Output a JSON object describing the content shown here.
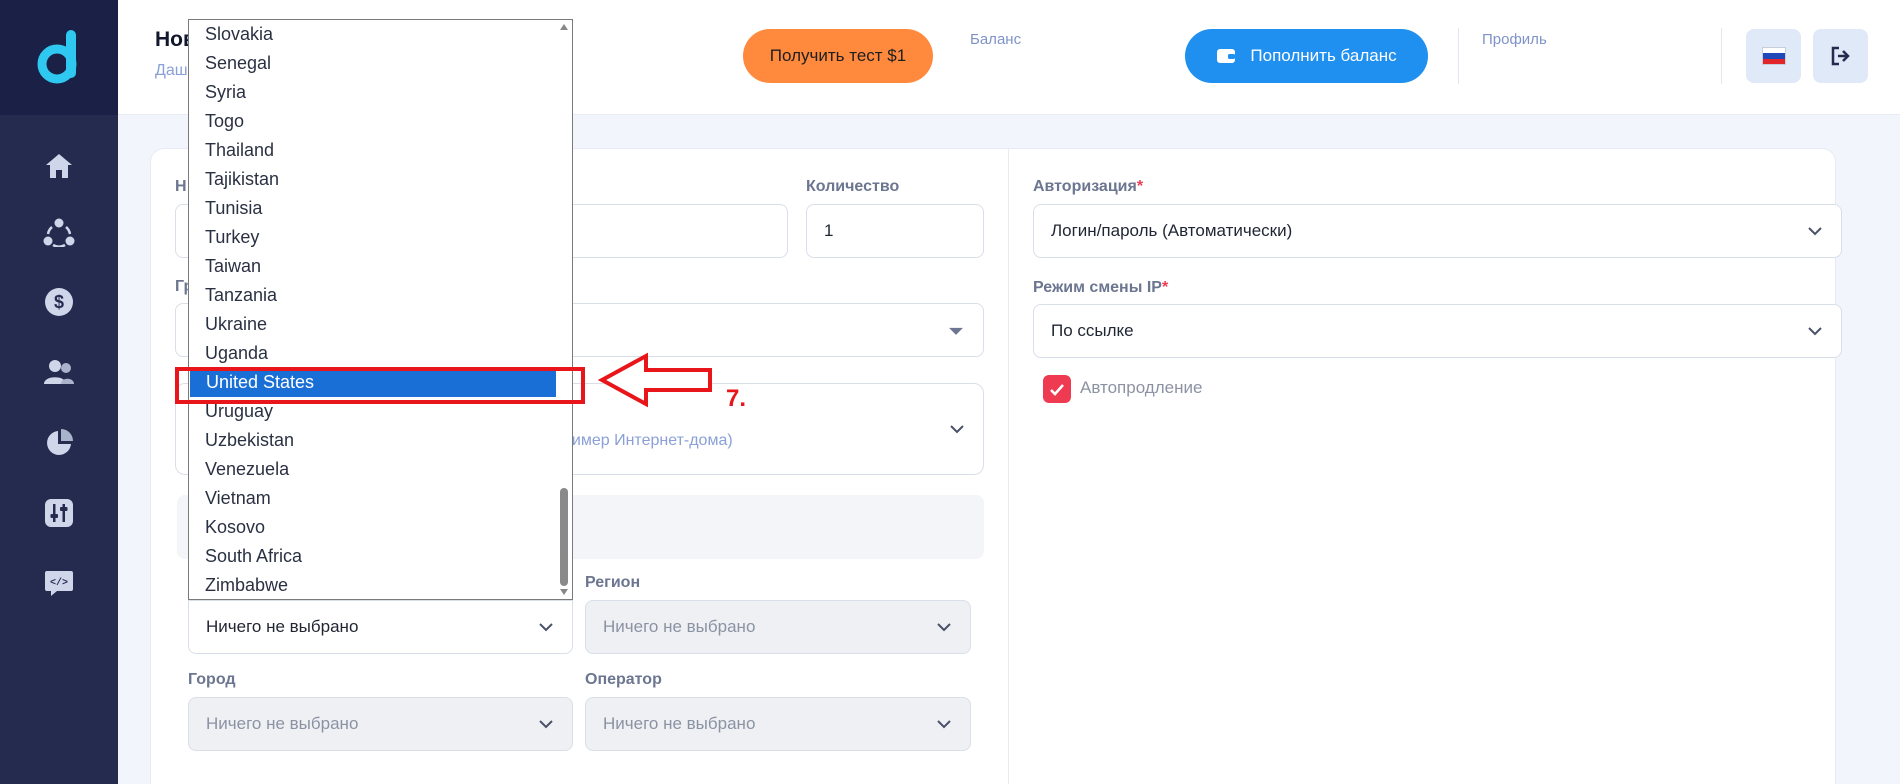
{
  "header": {
    "title": "Нов",
    "breadcrumb": "Даш",
    "test_button": "Получить тест $1",
    "balance_label": "Баланс",
    "topup_button": "Пополнить баланс",
    "profile_label": "Профиль"
  },
  "sidebar": {
    "logo": "d",
    "items": [
      {
        "icon": "home-icon"
      },
      {
        "icon": "network-icon"
      },
      {
        "icon": "dollar-icon"
      },
      {
        "icon": "users-icon"
      },
      {
        "icon": "pie-chart-icon"
      },
      {
        "icon": "sliders-icon"
      },
      {
        "icon": "api-code-icon"
      }
    ]
  },
  "form": {
    "name_label_partial": "Н",
    "quantity_label": "Количество",
    "quantity_value": "1",
    "group_label_partial": "Гр",
    "type_hint_partial": "ример Интернет-дома)",
    "authorization_label": "Авторизация",
    "authorization_value": "Логин/пароль (Автоматически)",
    "ip_mode_label": "Режим смены IP",
    "ip_mode_value": "По ссылке",
    "autorenew_label": "Автопродление",
    "country_value": "Ничего не выбрано",
    "region_label": "Регион",
    "region_value": "Ничего не выбрано",
    "city_label": "Город",
    "city_value": "Ничего не выбрано",
    "operator_label": "Оператор",
    "operator_value": "Ничего не выбрано"
  },
  "country_dropdown": {
    "options": [
      "Slovakia",
      "Senegal",
      "Syria",
      "Togo",
      "Thailand",
      "Tajikistan",
      "Tunisia",
      "Turkey",
      "Taiwan",
      "Tanzania",
      "Ukraine",
      "Uganda",
      "United States",
      "Uruguay",
      "Uzbekistan",
      "Venezuela",
      "Vietnam",
      "Kosovo",
      "South Africa",
      "Zimbabwe"
    ],
    "selected": "United States"
  },
  "annotation": {
    "step": "7."
  },
  "colors": {
    "sidebar": "#252b4f",
    "accent_orange": "#ff8a3d",
    "accent_blue": "#1f8ff0",
    "selected_option": "#1a6fd6",
    "annotation_red": "#e8161b",
    "checkbox_red": "#ef3b52"
  }
}
